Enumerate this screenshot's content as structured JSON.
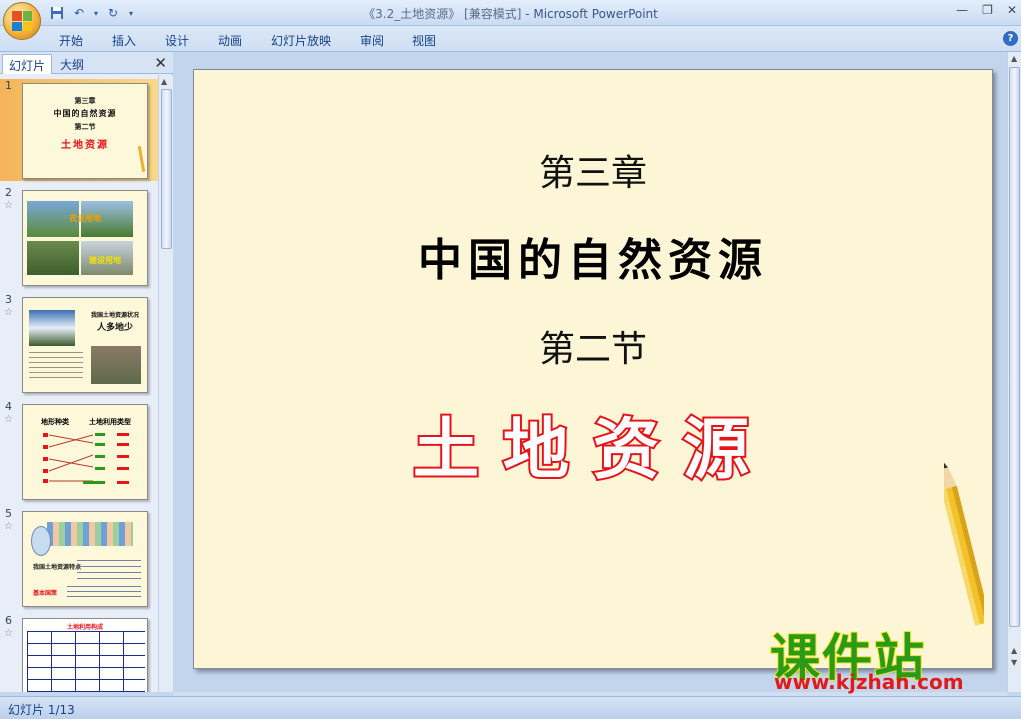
{
  "window": {
    "doc_title": "《3.2_土地资源》 [兼容模式]",
    "separator": " - ",
    "app_name": "Microsoft PowerPoint",
    "minimize": "—",
    "restore": "❐",
    "close": "✕"
  },
  "qat": {
    "save_icon": "save-icon",
    "undo_icon": "undo-icon",
    "redo_icon": "redo-icon",
    "customize_icon": "customize-icon"
  },
  "ribbon_tabs": [
    "开始",
    "插入",
    "设计",
    "动画",
    "幻灯片放映",
    "审阅",
    "视图"
  ],
  "left_panel": {
    "tab_slides": "幻灯片",
    "tab_outline": "大纲",
    "close": "✕",
    "thumbnails": [
      {
        "num": "1",
        "lines": [
          "第三章",
          "中国的自然资源",
          "第二节",
          "土地资源"
        ]
      },
      {
        "num": "2",
        "lines": [
          "农业用地",
          "建设用地"
        ]
      },
      {
        "num": "3",
        "lines": [
          "我国土地资源状况",
          "人多地少"
        ]
      },
      {
        "num": "4",
        "lines": [
          "地形种类",
          "土地利用类型"
        ]
      },
      {
        "num": "5",
        "lines": [
          "我国土地资源特点",
          "基本国策"
        ]
      },
      {
        "num": "6",
        "lines": [
          "土地利用构成"
        ]
      }
    ]
  },
  "slide": {
    "chapter": "第三章",
    "title": "中国的自然资源",
    "section": "第二节",
    "topic": "土地资源"
  },
  "status_bar": {
    "slide_indicator": "幻灯片 1/13"
  },
  "watermark": {
    "main": "课件站",
    "url": "www.kjzhan.com"
  },
  "colors": {
    "topic_outline": "#e8141a",
    "watermark_green": "#2a9a1a",
    "watermark_url": "#e11a1a",
    "slide_bg": "#fdf6d6"
  }
}
